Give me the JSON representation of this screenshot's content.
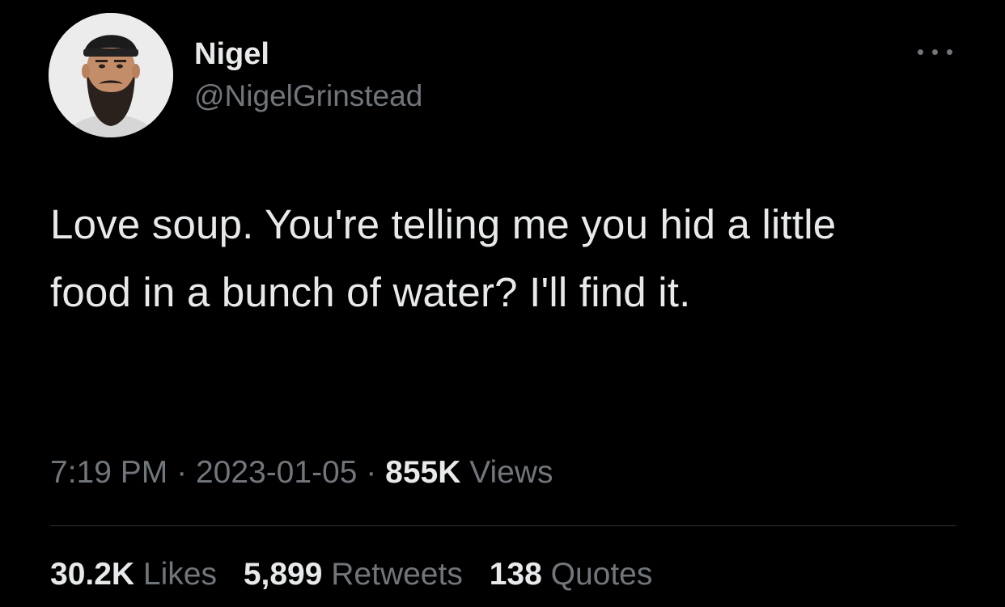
{
  "author": {
    "name": "Nigel",
    "handle": "@NigelGrinstead"
  },
  "tweet": {
    "text": "Love soup. You're telling me you hid a little food in a bunch of water? I'll find it.",
    "time": "7:19 PM",
    "separator": "·",
    "date": "2023-01-05",
    "views_count": "855K",
    "views_label": "Views"
  },
  "stats": [
    {
      "count": "30.2K",
      "label": "Likes"
    },
    {
      "count": "5,899",
      "label": "Retweets"
    },
    {
      "count": "138",
      "label": "Quotes"
    }
  ],
  "icons": {
    "more": "more-dots-icon"
  },
  "colors": {
    "background": "#000000",
    "primary_text": "#e7e9ea",
    "secondary_text": "#71767b",
    "divider": "#2f3336"
  }
}
